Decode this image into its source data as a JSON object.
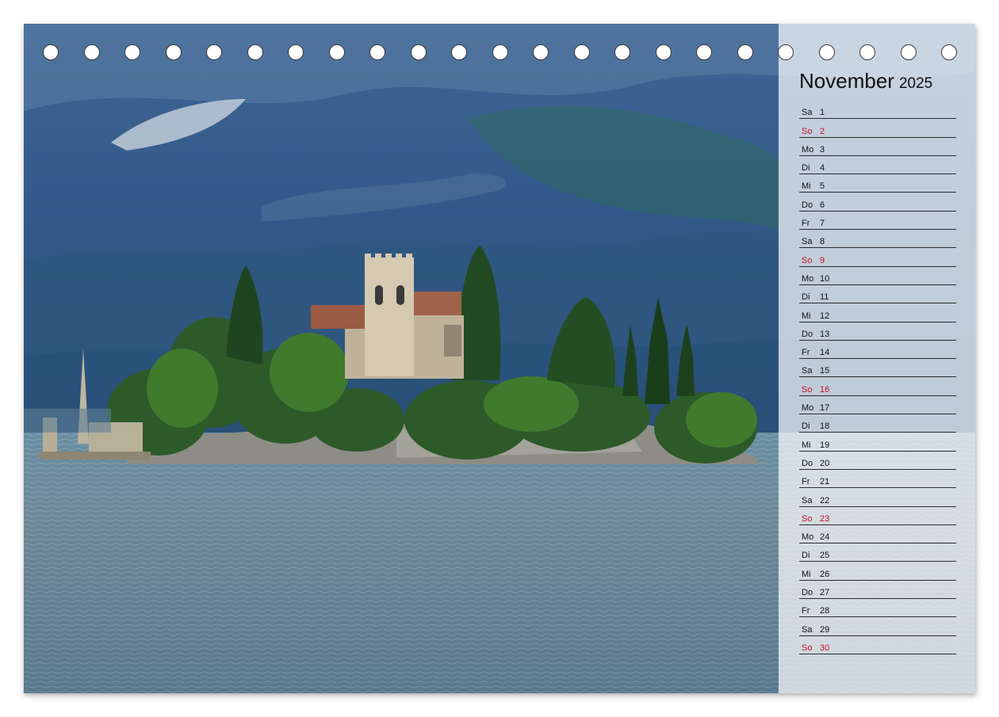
{
  "calendar": {
    "month": "November",
    "year": "2025",
    "days": [
      {
        "weekday": "Sa",
        "day": "1",
        "sunday": false
      },
      {
        "weekday": "So",
        "day": "2",
        "sunday": true
      },
      {
        "weekday": "Mo",
        "day": "3",
        "sunday": false
      },
      {
        "weekday": "Di",
        "day": "4",
        "sunday": false
      },
      {
        "weekday": "Mi",
        "day": "5",
        "sunday": false
      },
      {
        "weekday": "Do",
        "day": "6",
        "sunday": false
      },
      {
        "weekday": "Fr",
        "day": "7",
        "sunday": false
      },
      {
        "weekday": "Sa",
        "day": "8",
        "sunday": false
      },
      {
        "weekday": "So",
        "day": "9",
        "sunday": true
      },
      {
        "weekday": "Mo",
        "day": "10",
        "sunday": false
      },
      {
        "weekday": "Di",
        "day": "11",
        "sunday": false
      },
      {
        "weekday": "Mi",
        "day": "12",
        "sunday": false
      },
      {
        "weekday": "Do",
        "day": "13",
        "sunday": false
      },
      {
        "weekday": "Fr",
        "day": "14",
        "sunday": false
      },
      {
        "weekday": "Sa",
        "day": "15",
        "sunday": false
      },
      {
        "weekday": "So",
        "day": "16",
        "sunday": true
      },
      {
        "weekday": "Mo",
        "day": "17",
        "sunday": false
      },
      {
        "weekday": "Di",
        "day": "18",
        "sunday": false
      },
      {
        "weekday": "Mi",
        "day": "19",
        "sunday": false
      },
      {
        "weekday": "Do",
        "day": "20",
        "sunday": false
      },
      {
        "weekday": "Fr",
        "day": "21",
        "sunday": false
      },
      {
        "weekday": "Sa",
        "day": "22",
        "sunday": false
      },
      {
        "weekday": "So",
        "day": "23",
        "sunday": true
      },
      {
        "weekday": "Mo",
        "day": "24",
        "sunday": false
      },
      {
        "weekday": "Di",
        "day": "25",
        "sunday": false
      },
      {
        "weekday": "Mi",
        "day": "26",
        "sunday": false
      },
      {
        "weekday": "Do",
        "day": "27",
        "sunday": false
      },
      {
        "weekday": "Fr",
        "day": "28",
        "sunday": false
      },
      {
        "weekday": "Sa",
        "day": "29",
        "sunday": false
      },
      {
        "weekday": "So",
        "day": "30",
        "sunday": true
      }
    ]
  },
  "colors": {
    "sunday": "#c8102e",
    "text": "#111111",
    "rule": "#2b2b2b"
  }
}
